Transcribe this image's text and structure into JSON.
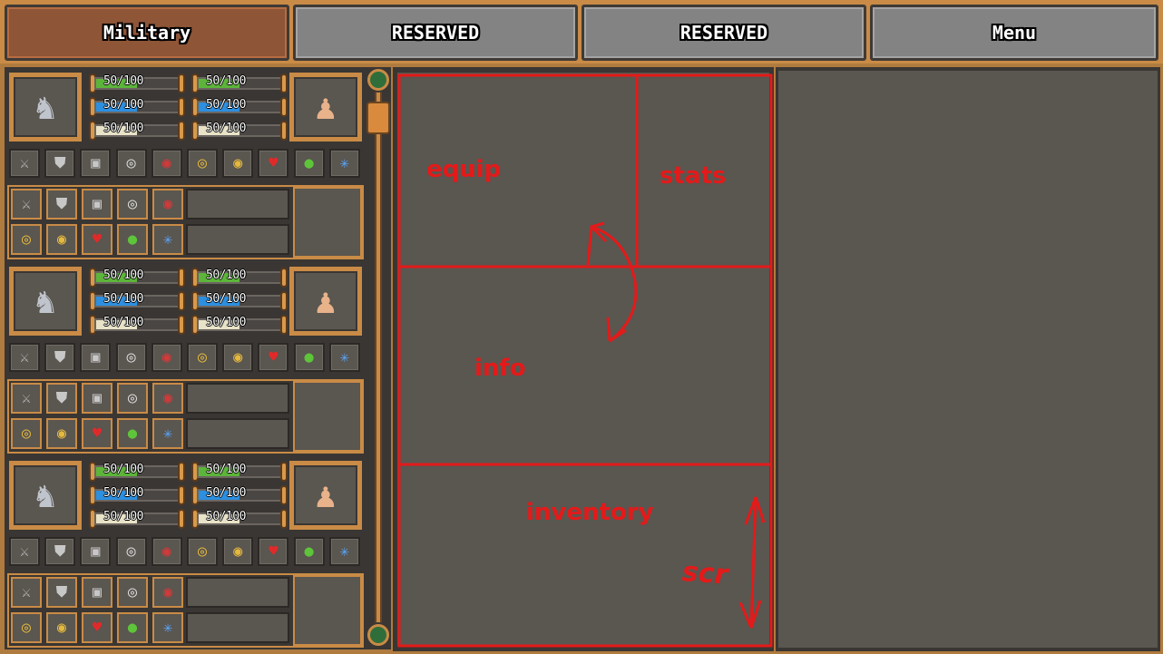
{
  "tabs": [
    {
      "label": "Military",
      "active": true
    },
    {
      "label": "RESERVED",
      "active": false
    },
    {
      "label": "RESERVED",
      "active": false
    },
    {
      "label": "Menu",
      "active": false
    }
  ],
  "units": [
    {
      "bars": [
        {
          "text": "50/100",
          "value": 50,
          "max": 100,
          "color": "#5cb53a"
        },
        {
          "text": "50/100",
          "value": 50,
          "max": 100,
          "color": "#5cb53a"
        },
        {
          "text": "50/100",
          "value": 50,
          "max": 100,
          "color": "#2c8fe0"
        },
        {
          "text": "50/100",
          "value": 50,
          "max": 100,
          "color": "#2c8fe0"
        },
        {
          "text": "50/100",
          "value": 50,
          "max": 100,
          "color": "#e8e3c8"
        },
        {
          "text": "50/100",
          "value": 50,
          "max": 100,
          "color": "#e8e3c8"
        }
      ]
    },
    {
      "bars": [
        {
          "text": "50/100",
          "value": 50,
          "max": 100,
          "color": "#5cb53a"
        },
        {
          "text": "50/100",
          "value": 50,
          "max": 100,
          "color": "#5cb53a"
        },
        {
          "text": "50/100",
          "value": 50,
          "max": 100,
          "color": "#2c8fe0"
        },
        {
          "text": "50/100",
          "value": 50,
          "max": 100,
          "color": "#2c8fe0"
        },
        {
          "text": "50/100",
          "value": 50,
          "max": 100,
          "color": "#e8e3c8"
        },
        {
          "text": "50/100",
          "value": 50,
          "max": 100,
          "color": "#e8e3c8"
        }
      ]
    },
    {
      "bars": [
        {
          "text": "50/100",
          "value": 50,
          "max": 100,
          "color": "#5cb53a"
        },
        {
          "text": "50/100",
          "value": 50,
          "max": 100,
          "color": "#5cb53a"
        },
        {
          "text": "50/100",
          "value": 50,
          "max": 100,
          "color": "#2c8fe0"
        },
        {
          "text": "50/100",
          "value": 50,
          "max": 100,
          "color": "#2c8fe0"
        },
        {
          "text": "50/100",
          "value": 50,
          "max": 100,
          "color": "#e8e3c8"
        },
        {
          "text": "50/100",
          "value": 50,
          "max": 100,
          "color": "#e8e3c8"
        }
      ]
    }
  ],
  "equipment_slots": [
    "sword-icon",
    "shield-icon",
    "armor-icon",
    "silver-ring-icon",
    "ruby-ring-icon",
    "gold-ring-icon",
    "amber-ring-icon",
    "heart-icon",
    "apple-icon",
    "wand-icon"
  ],
  "annotations": {
    "equip": "equip",
    "stats": "stats",
    "info": "info",
    "inventory": "inventory",
    "scroll": "scr"
  },
  "colors": {
    "accent_brown": "#c98b46",
    "active_tab": "#8e5537",
    "panel_gray": "#5a5650",
    "sketch_red": "#e41a1a"
  }
}
